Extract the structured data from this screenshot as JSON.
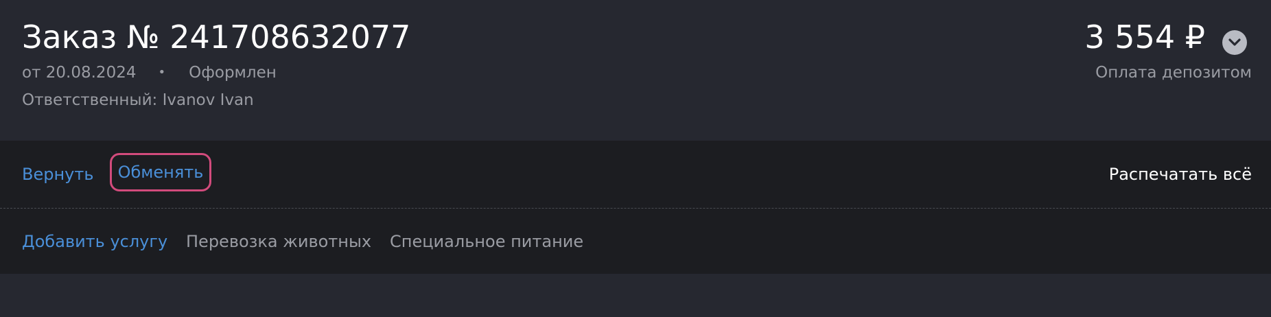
{
  "order": {
    "title": "Заказ № 241708632077",
    "date": "от 20.08.2024",
    "separator": "•",
    "status": "Оформлен",
    "responsible": "Ответственный: Ivanov Ivan",
    "price": "3 554 ₽",
    "payment_method": "Оплата депозитом",
    "expand_icon": "chevron-down-icon"
  },
  "actions": {
    "return_label": "Вернуть",
    "exchange_label": "Обменять",
    "print_all_label": "Распечатать всё"
  },
  "services": {
    "add_label": "Добавить услугу",
    "items": [
      "Перевозка животных",
      "Специальное питание"
    ]
  },
  "colors": {
    "background": "#262830",
    "bar_background": "#1c1d21",
    "link": "#4a8fd8",
    "muted_text": "#9a9ca3",
    "highlight_border": "#d24b7c"
  }
}
